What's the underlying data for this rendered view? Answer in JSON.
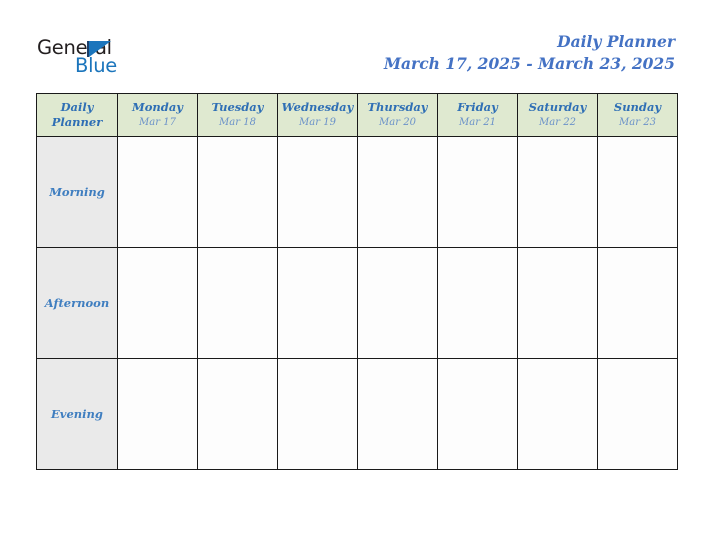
{
  "brand": {
    "name_part1": "General",
    "name_part2": "Blue",
    "triangle_icon": "triangle-icon",
    "colors": {
      "dark": "#231f20",
      "blue": "#1b75bc"
    }
  },
  "header": {
    "title": "Daily Planner",
    "date_range": "March 17, 2025 - March 23, 2025"
  },
  "planner": {
    "corner_label_line1": "Daily",
    "corner_label_line2": "Planner",
    "accent_colors": {
      "header_bg": "#dfe9d0",
      "row_label_bg": "#eaeaea",
      "cell_bg": "#fdfdfd",
      "text_blue": "#2f6fb5",
      "date_blue": "#6b92c9",
      "border": "#1a1a1a",
      "title_blue": "#4472c4"
    },
    "days": [
      {
        "name": "Monday",
        "date": "Mar 17"
      },
      {
        "name": "Tuesday",
        "date": "Mar 18"
      },
      {
        "name": "Wednesday",
        "date": "Mar 19"
      },
      {
        "name": "Thursday",
        "date": "Mar 20"
      },
      {
        "name": "Friday",
        "date": "Mar 21"
      },
      {
        "name": "Saturday",
        "date": "Mar 22"
      },
      {
        "name": "Sunday",
        "date": "Mar 23"
      }
    ],
    "time_slots": [
      {
        "label": "Morning",
        "entries": [
          "",
          "",
          "",
          "",
          "",
          "",
          ""
        ]
      },
      {
        "label": "Afternoon",
        "entries": [
          "",
          "",
          "",
          "",
          "",
          "",
          ""
        ]
      },
      {
        "label": "Evening",
        "entries": [
          "",
          "",
          "",
          "",
          "",
          "",
          ""
        ]
      }
    ]
  }
}
